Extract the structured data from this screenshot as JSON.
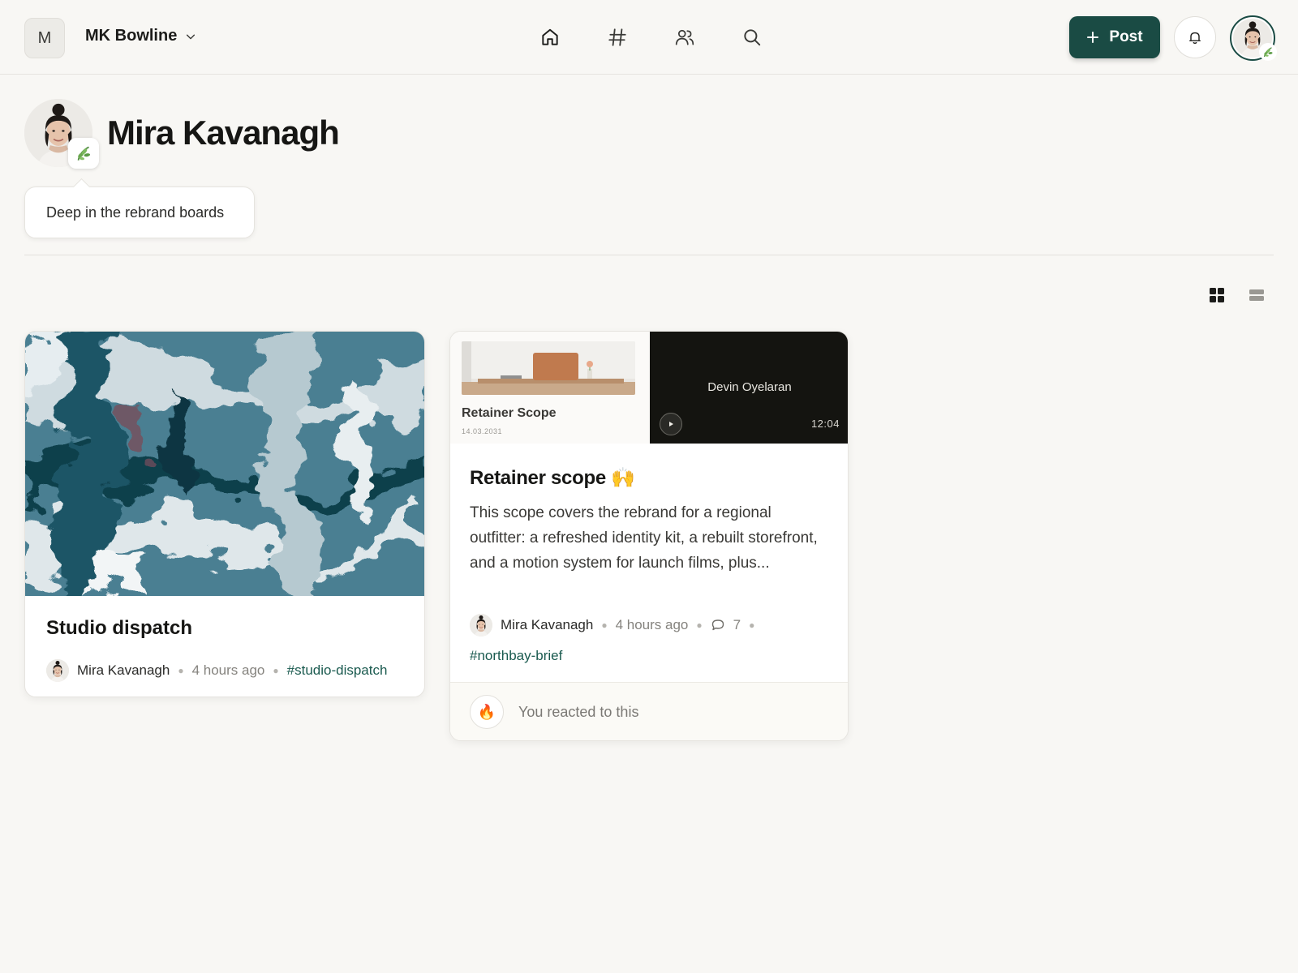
{
  "workspace": {
    "badge": "M",
    "name": "MK Bowline"
  },
  "nav": {
    "icons": [
      "home-icon",
      "hashtag-icon",
      "people-icon",
      "search-icon"
    ]
  },
  "header_actions": {
    "post_label": "Post",
    "bell_icon": "bell-icon"
  },
  "profile": {
    "name": "Mira Kavanagh",
    "status": "Deep in the rebrand boards"
  },
  "colors": {
    "accent": "#1a4b44",
    "tag": "#1a5a4f",
    "background": "#f8f7f4"
  },
  "cards": [
    {
      "title": "Studio dispatch",
      "author": "Mira Kavanagh",
      "time": "4 hours ago",
      "tag": "#studio-dispatch"
    },
    {
      "doc_title": "Retainer Scope",
      "doc_date": "14.03.2031",
      "video_name": "Devin Oyelaran",
      "video_duration": "12:04",
      "title": "Retainer scope 🙌",
      "body": "This scope covers the rebrand for a regional outfitter: a refreshed identity kit, a rebuilt storefront, and a motion system for launch films, plus...",
      "author": "Mira Kavanagh",
      "time": "4 hours ago",
      "comments": "7",
      "tag": "#northbay-brief",
      "reaction_emoji": "🔥",
      "reaction_text": "You reacted to this"
    }
  ]
}
